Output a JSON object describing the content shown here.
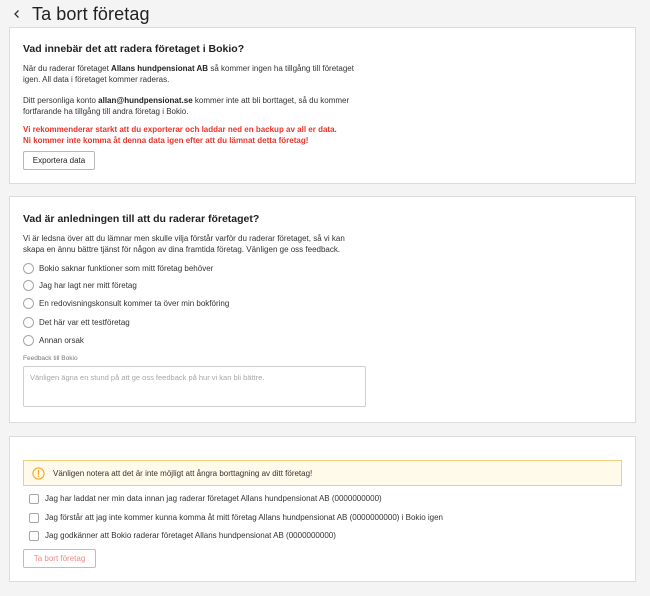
{
  "header": {
    "title": "Ta bort företag",
    "back_icon": "chevron-left-icon"
  },
  "info": {
    "title": "Vad innebär det att radera företaget i Bokio?",
    "p1_before": "När du raderar företaget ",
    "p1_company": "Allans hundpensionat AB",
    "p1_after": " så kommer ingen ha tillgång till företaget igen. All data i företaget kommer raderas.",
    "p2_before": "Ditt personliga konto ",
    "p2_email": "allan@hundpensionat.se",
    "p2_after": " kommer inte att bli borttaget, så du kommer fortfarande ha tillgång till andra företag i Bokio.",
    "warning_line1": "Vi rekommenderar starkt att du exporterar och laddar ned en backup av all er data.",
    "warning_line2": "Ni kommer inte komma åt denna data igen efter att du lämnat detta företag!",
    "export_button": "Exportera data"
  },
  "reason": {
    "title": "Vad är anledningen till att du raderar företaget?",
    "intro": "Vi är ledsna över att du lämnar men skulle vilja förstår varför du raderar företaget, så vi kan skapa en ännu bättre tjänst för någon av dina framtida företag. Vänligen ge oss feedback.",
    "options": [
      "Bokio saknar funktioner som mitt företag behöver",
      "Jag har lagt ner mitt företag",
      "En redovisningskonsult kommer ta över min bokföring",
      "Det här var ett testföretag",
      "Annan orsak"
    ],
    "feedback_label": "Feedback till Bokio",
    "feedback_placeholder": "Vänligen ägna en stund på att ge oss feedback på hur vi kan bli bättre."
  },
  "confirm": {
    "notice": "Vänligen notera att det är inte möjligt att ångra borttagning av ditt företag!",
    "notice_icon": "warning-circle-icon",
    "checks": [
      "Jag har laddat ner min data innan jag raderar företaget Allans hundpensionat AB (0000000000)",
      "Jag förstår att jag inte kommer kunna komma åt mitt företag Allans hundpensionat AB (0000000000) i Bokio igen",
      "Jag godkänner att Bokio raderar företaget Allans hundpensionat AB (0000000000)"
    ],
    "delete_button": "Ta bort företag"
  },
  "colors": {
    "danger": "#e8352b",
    "warning_border": "#f0cf7c",
    "warning_bg": "#fffaea"
  }
}
